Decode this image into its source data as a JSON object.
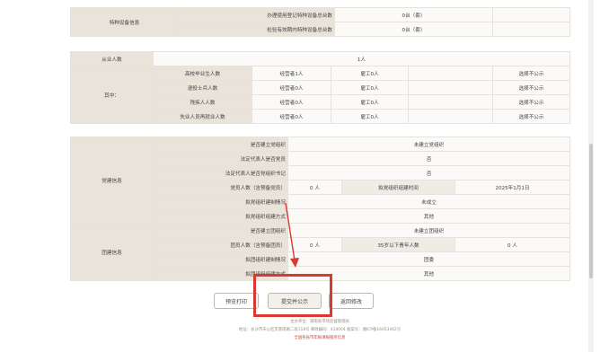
{
  "special_equipment": {
    "section_label": "特种设备信息",
    "rows": [
      {
        "label": "办理使用登记特种设备总台数",
        "value": "0台（套）"
      },
      {
        "label": "检验有效期内特种设备总台数",
        "value": "0台（套）"
      }
    ]
  },
  "employees": {
    "header_label": "从业人数",
    "header_value": "1人",
    "sub_label": "其中：",
    "rows": [
      {
        "label": "高校毕业生人数",
        "manager": "经营者1人",
        "hired": "雇工0人",
        "visibility": "选择不公示"
      },
      {
        "label": "退役士兵人数",
        "manager": "经营者0人",
        "hired": "雇工0人",
        "visibility": "选择不公示"
      },
      {
        "label": "残疾人人数",
        "manager": "经营者0人",
        "hired": "雇工0人",
        "visibility": "选择不公示"
      },
      {
        "label": "失业人员再就业人数",
        "manager": "经营者0人",
        "hired": "雇工0人",
        "visibility": "选择不公示"
      }
    ]
  },
  "party": {
    "section_label": "党建信息",
    "rows": {
      "established": {
        "label": "是否建立党组织",
        "value": "未建立党组织"
      },
      "rep_member": {
        "label": "法定代表人是否党员",
        "value": "否"
      },
      "rep_secretary": {
        "label": "法定代表人是否党组织书记",
        "value": "否"
      },
      "members": {
        "label": "党员人数（含预备党员）",
        "value": "0 人",
        "mid_label": "拟党组织组建时间",
        "mid_value": "2025年1月1日"
      },
      "build_status": {
        "label": "拟党组织建制情况",
        "value": "未成立"
      },
      "build_method": {
        "label": "拟党组织组建方式",
        "value": "其他"
      }
    }
  },
  "league": {
    "section_label": "团建信息",
    "rows": {
      "established": {
        "label": "是否建立团组织",
        "value": "未建立团组织"
      },
      "members": {
        "label": "团员人数（含预备团员）",
        "value": "0 人",
        "mid_label": "35岁以下青年人数",
        "mid_value": "0 人"
      },
      "build_status": {
        "label": "拟团组织建制情况",
        "value": "团委"
      },
      "build_method": {
        "label": "拟团组织组建方式",
        "value": "其他"
      }
    }
  },
  "buttons": {
    "preview_print": "预览打印",
    "submit_publish": "提交并公示",
    "back_edit": "返回修改"
  },
  "footer": {
    "line1": "主办单位：湖南省市场监督管理局",
    "line2": "地址：长沙市天心区芙蓉南路二段118号 邮政编码：410004 备案号：湘ICP备16053442号",
    "line3": "全国各省市年报填报服务信息"
  },
  "colors": {
    "highlight_box": "#d93a30",
    "arrow": "#d93a30",
    "label_bg": "#e9e3da"
  }
}
